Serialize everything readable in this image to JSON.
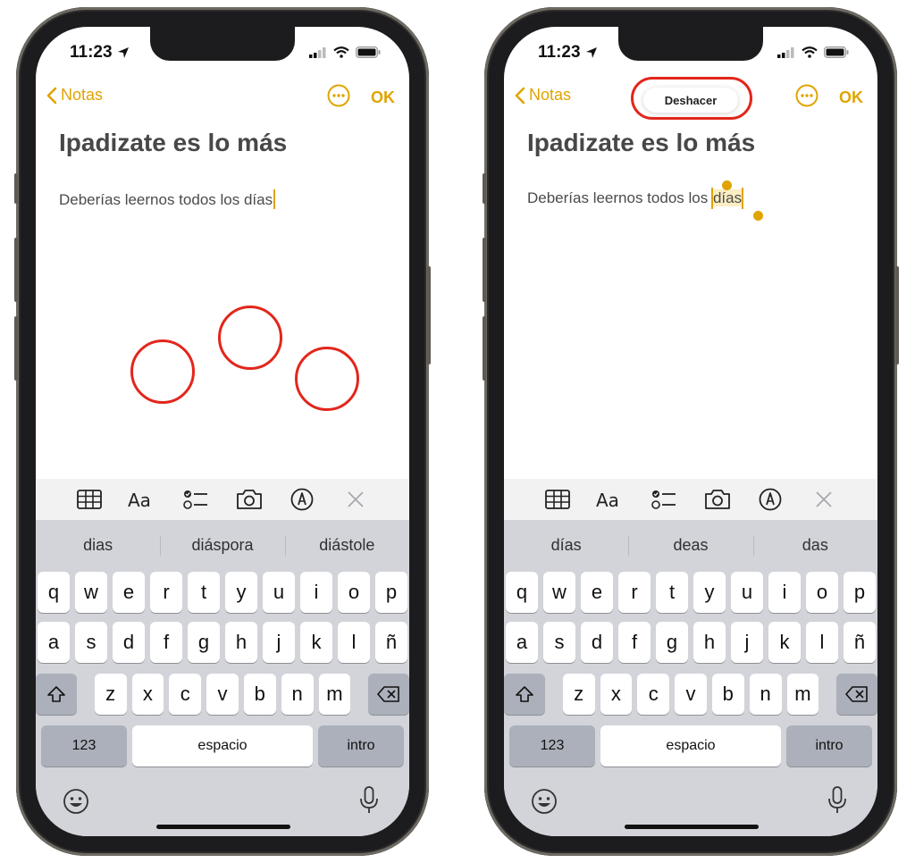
{
  "phones": [
    {
      "status": {
        "time": "11:23"
      },
      "nav": {
        "back_label": "Notas",
        "ok_label": "OK"
      },
      "note": {
        "title": "Ipadizate es lo más",
        "body": "Deberías leernos todos los días"
      },
      "suggestions": [
        "dias",
        "diáspora",
        "diástole"
      ]
    },
    {
      "status": {
        "time": "11:23"
      },
      "nav": {
        "back_label": "Notas",
        "ok_label": "OK",
        "undo_label": "Deshacer"
      },
      "note": {
        "title": "Ipadizate es lo más",
        "body_prefix": "Deberías leernos todos los ",
        "body_selected": "días"
      },
      "suggestions": [
        "días",
        "deas",
        "das"
      ]
    }
  ],
  "keyboard": {
    "row1": [
      "q",
      "w",
      "e",
      "r",
      "t",
      "y",
      "u",
      "i",
      "o",
      "p"
    ],
    "row2": [
      "a",
      "s",
      "d",
      "f",
      "g",
      "h",
      "j",
      "k",
      "l",
      "ñ"
    ],
    "row3": [
      "z",
      "x",
      "c",
      "v",
      "b",
      "n",
      "m"
    ],
    "numbers_label": "123",
    "space_label": "espacio",
    "return_label": "intro"
  },
  "icons": {
    "toolbar": [
      "table-icon",
      "format-text-icon",
      "checklist-icon",
      "camera-icon",
      "markup-pen-icon",
      "close-icon"
    ],
    "status": [
      "location-arrow-icon",
      "signal-icon",
      "wifi-icon",
      "battery-icon"
    ],
    "dock": [
      "emoji-icon",
      "microphone-icon"
    ]
  },
  "colors": {
    "accent": "#e0a400",
    "annotation": "#e3261b",
    "keyboard_bg": "#d2d4da",
    "toolbar_bg": "#f2f2f3"
  }
}
